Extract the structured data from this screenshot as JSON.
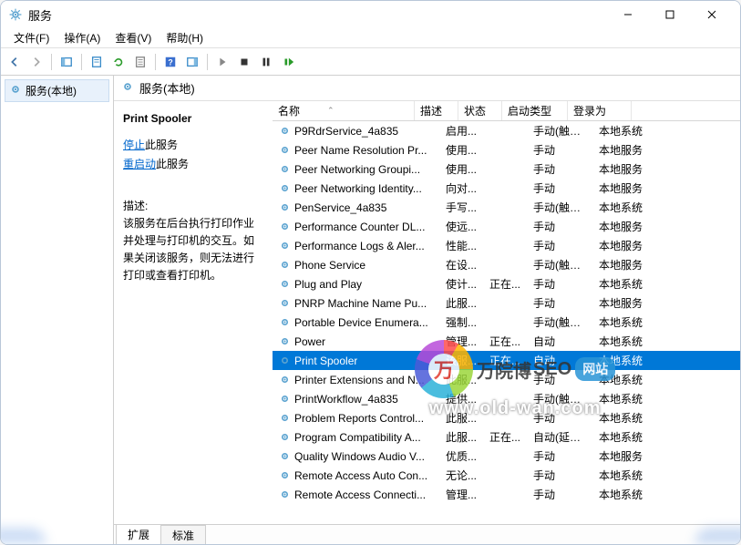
{
  "titlebar": {
    "title": "服务"
  },
  "menubar": {
    "items": [
      "文件(F)",
      "操作(A)",
      "查看(V)",
      "帮助(H)"
    ]
  },
  "tree": {
    "node": "服务(本地)"
  },
  "panel": {
    "heading": "服务(本地)"
  },
  "detail": {
    "service_name": "Print Spooler",
    "stop_link": "停止",
    "stop_suffix": "此服务",
    "restart_link": "重启动",
    "restart_suffix": "此服务",
    "desc_label": "描述:",
    "desc_text": "该服务在后台执行打印作业并处理与打印机的交互。如果关闭该服务，则无法进行打印或查看打印机。"
  },
  "columns": {
    "name": "名称",
    "desc": "描述",
    "status": "状态",
    "startup": "启动类型",
    "logon": "登录为"
  },
  "services": [
    {
      "name": "P9RdrService_4a835",
      "desc": "启用...",
      "status": "",
      "startup": "手动(触发...",
      "logon": "本地系统"
    },
    {
      "name": "Peer Name Resolution Pr...",
      "desc": "使用...",
      "status": "",
      "startup": "手动",
      "logon": "本地服务"
    },
    {
      "name": "Peer Networking Groupi...",
      "desc": "使用...",
      "status": "",
      "startup": "手动",
      "logon": "本地服务"
    },
    {
      "name": "Peer Networking Identity...",
      "desc": "向对...",
      "status": "",
      "startup": "手动",
      "logon": "本地服务"
    },
    {
      "name": "PenService_4a835",
      "desc": "手写...",
      "status": "",
      "startup": "手动(触发...",
      "logon": "本地系统"
    },
    {
      "name": "Performance Counter DL...",
      "desc": "使远...",
      "status": "",
      "startup": "手动",
      "logon": "本地服务"
    },
    {
      "name": "Performance Logs & Aler...",
      "desc": "性能...",
      "status": "",
      "startup": "手动",
      "logon": "本地服务"
    },
    {
      "name": "Phone Service",
      "desc": "在设...",
      "status": "",
      "startup": "手动(触发...",
      "logon": "本地服务"
    },
    {
      "name": "Plug and Play",
      "desc": "使计...",
      "status": "正在...",
      "startup": "手动",
      "logon": "本地系统"
    },
    {
      "name": "PNRP Machine Name Pu...",
      "desc": "此服...",
      "status": "",
      "startup": "手动",
      "logon": "本地服务"
    },
    {
      "name": "Portable Device Enumera...",
      "desc": "强制...",
      "status": "",
      "startup": "手动(触发...",
      "logon": "本地系统"
    },
    {
      "name": "Power",
      "desc": "管理...",
      "status": "正在...",
      "startup": "自动",
      "logon": "本地系统"
    },
    {
      "name": "Print Spooler",
      "desc": "该服...",
      "status": "正在...",
      "startup": "自动",
      "logon": "本地系统",
      "selected": true
    },
    {
      "name": "Printer Extensions and N...",
      "desc": "此服...",
      "status": "",
      "startup": "手动",
      "logon": "本地系统"
    },
    {
      "name": "PrintWorkflow_4a835",
      "desc": "提供...",
      "status": "",
      "startup": "手动(触发...",
      "logon": "本地系统"
    },
    {
      "name": "Problem Reports Control...",
      "desc": "此服...",
      "status": "",
      "startup": "手动",
      "logon": "本地系统"
    },
    {
      "name": "Program Compatibility A...",
      "desc": "此服...",
      "status": "正在...",
      "startup": "自动(延迟...",
      "logon": "本地系统"
    },
    {
      "name": "Quality Windows Audio V...",
      "desc": "优质...",
      "status": "",
      "startup": "手动",
      "logon": "本地服务"
    },
    {
      "name": "Remote Access Auto Con...",
      "desc": "无论...",
      "status": "",
      "startup": "手动",
      "logon": "本地系统"
    },
    {
      "name": "Remote Access Connecti...",
      "desc": "管理...",
      "status": "",
      "startup": "手动",
      "logon": "本地系统"
    }
  ],
  "tabs": {
    "extended": "扩展",
    "standard": "标准"
  },
  "watermark": {
    "logo_char": "万",
    "text_zh": "万院博",
    "text_seo": "SEO",
    "badge": "网站",
    "url": "www.old-wan.com"
  }
}
